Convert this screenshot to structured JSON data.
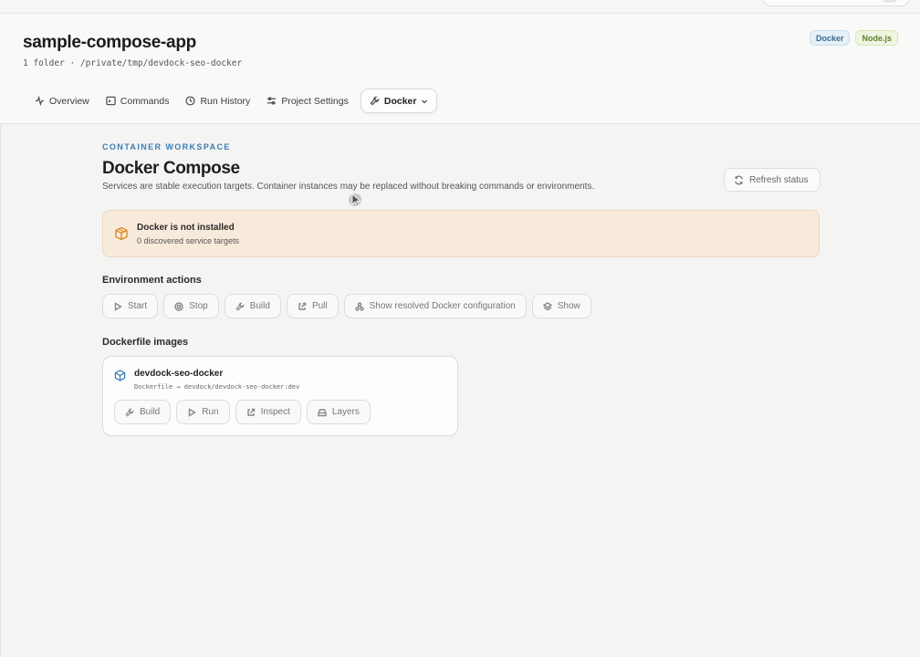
{
  "header": {
    "title": "sample-compose-app",
    "path": "1 folder · /private/tmp/devdock-seo-docker",
    "badges": [
      "Docker",
      "Node.js"
    ]
  },
  "tabs": [
    {
      "label": "Overview",
      "icon": "activity-icon"
    },
    {
      "label": "Commands",
      "icon": "terminal-icon"
    },
    {
      "label": "Run History",
      "icon": "clock-icon"
    },
    {
      "label": "Project Settings",
      "icon": "sliders-icon"
    },
    {
      "label": "Docker",
      "icon": "wrench-icon",
      "active": true
    }
  ],
  "main": {
    "eyebrow": "CONTAINER WORKSPACE",
    "title": "Docker Compose",
    "description": "Services are stable execution targets. Container instances may be replaced without breaking commands or environments.",
    "refresh_label": "Refresh status"
  },
  "alert": {
    "title": "Docker is not installed",
    "subtitle": "0 discovered service targets",
    "color": "#f8eadb"
  },
  "environment_actions": {
    "title": "Environment actions",
    "buttons": [
      {
        "label": "Start",
        "icon": "play-icon"
      },
      {
        "label": "Stop",
        "icon": "stop-circle-icon"
      },
      {
        "label": "Build",
        "icon": "wrench-icon"
      },
      {
        "label": "Pull",
        "icon": "external-link-icon"
      },
      {
        "label": "Show resolved Docker configuration",
        "icon": "network-icon"
      },
      {
        "label": "Show",
        "icon": "layers-icon"
      }
    ]
  },
  "dockerfile_images": {
    "title": "Dockerfile images",
    "items": [
      {
        "name": "devdock-seo-docker",
        "detail": "Dockerfile → devdock/devdock-seo-docker:dev",
        "buttons": [
          {
            "label": "Build",
            "icon": "wrench-icon"
          },
          {
            "label": "Run",
            "icon": "play-icon"
          },
          {
            "label": "Inspect",
            "icon": "external-link-icon"
          },
          {
            "label": "Layers",
            "icon": "drive-icon"
          }
        ]
      }
    ]
  },
  "colors": {
    "accent": "#3b7db3",
    "background": "#f4f4f3",
    "alert_border": "#edd6bd"
  }
}
